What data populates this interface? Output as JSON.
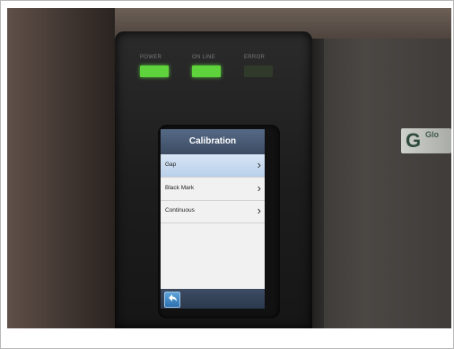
{
  "leds": [
    {
      "label": "POWER",
      "state": "on"
    },
    {
      "label": "ON LINE",
      "state": "on"
    },
    {
      "label": "ERROR",
      "state": "off"
    }
  ],
  "screen": {
    "title": "Calibration",
    "items": [
      {
        "label": "Gap",
        "selected": true
      },
      {
        "label": "Black Mark",
        "selected": false
      },
      {
        "label": "Continuous",
        "selected": false
      }
    ],
    "chevron": "›",
    "back_icon": "back-arrow-icon"
  },
  "brand": {
    "initial": "G",
    "text": "Glo"
  },
  "colors": {
    "led_on": "#5ed33b",
    "led_off": "#2f3a2a",
    "header": "#4a5b75",
    "selected_row": "#c6d9ef"
  }
}
